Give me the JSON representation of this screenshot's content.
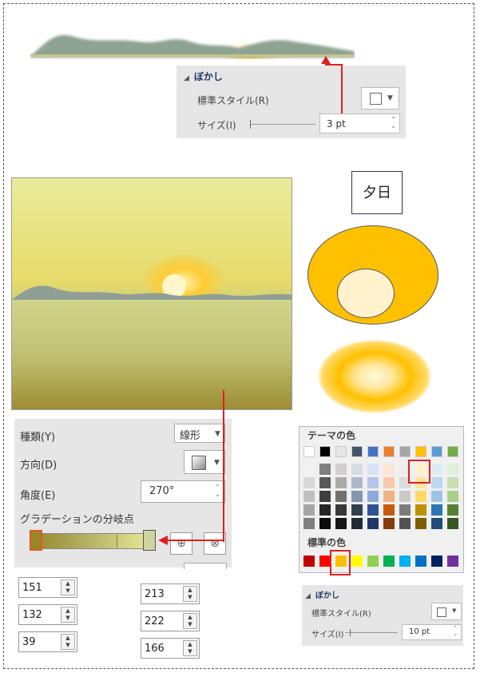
{
  "blur_panel_top": {
    "header": "ぼかし",
    "style_label": "標準スタイル(R)",
    "size_label": "サイズ(I)",
    "size_value": "3 pt"
  },
  "sun_label": "夕日",
  "gradient_panel": {
    "type_label": "種類(Y)",
    "type_value": "線形",
    "direction_label": "方向(D)",
    "angle_label": "角度(E)",
    "angle_value": "270°",
    "stops_label": "グラデーションの分岐点"
  },
  "rgb_left": [
    "151",
    "132",
    "39"
  ],
  "rgb_right": [
    "213",
    "222",
    "166"
  ],
  "palette": {
    "theme_header": "テーマの色",
    "standard_header": "標準の色",
    "theme_top": [
      "#ffffff",
      "#000000",
      "#e7e6e6",
      "#44546a",
      "#4472c4",
      "#ed7d31",
      "#a5a5a5",
      "#ffc000",
      "#5b9bd5",
      "#70ad47"
    ],
    "theme_shades": [
      [
        "#f2f2f2",
        "#7f7f7f",
        "#d0cece",
        "#d6dce4",
        "#d9e2f3",
        "#fbe5d5",
        "#ededed",
        "#fff2cc",
        "#deebf6",
        "#e2efd9"
      ],
      [
        "#d8d8d8",
        "#595959",
        "#aeaaaa",
        "#adb9ca",
        "#b4c6e7",
        "#f7caac",
        "#dbdbdb",
        "#fee599",
        "#bdd7ee",
        "#c5e0b3"
      ],
      [
        "#bfbfbf",
        "#3f3f3f",
        "#757070",
        "#8496b0",
        "#8eaadb",
        "#f4b183",
        "#c9c9c9",
        "#ffd965",
        "#9cc3e5",
        "#a8d08d"
      ],
      [
        "#a5a5a5",
        "#262626",
        "#3a3838",
        "#323f4f",
        "#2f5496",
        "#c55a11",
        "#7b7b7b",
        "#bf9000",
        "#2e75b5",
        "#538135"
      ],
      [
        "#7f7f7f",
        "#0c0c0c",
        "#171616",
        "#222a35",
        "#1f3864",
        "#833c0b",
        "#525252",
        "#7f6000",
        "#1e4e79",
        "#375623"
      ]
    ],
    "standard": [
      "#c00000",
      "#ff0000",
      "#ffc000",
      "#ffff00",
      "#92d050",
      "#00b050",
      "#00b0f0",
      "#0070c0",
      "#002060",
      "#7030a0"
    ]
  },
  "blur_panel_bottom": {
    "header": "ぼかし",
    "style_label": "標準スタイル(R)",
    "size_label": "サイズ(I)",
    "size_value": "10 pt"
  },
  "colors": {
    "accent_red": "#e02020",
    "sun_orange": "#ffc000",
    "sun_light": "#fff2cc"
  }
}
